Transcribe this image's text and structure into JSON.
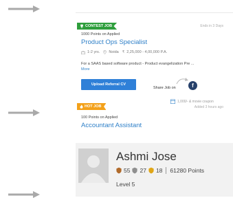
{
  "contest_job": {
    "badge": "CONTEST JOB",
    "ends_in": "Ends in 3 Days",
    "points": "1000 Points on Applied",
    "title": "Product Ops Specialist",
    "experience": "1-2 yrs.",
    "location": "Noida",
    "salary": "2,25,000 - 4,00,000 P.A.",
    "description": "For a SAAS based software product - Product evangelization Pre ...",
    "more_link": "More",
    "upload_button": "Upload Referral CV",
    "share_label": "Share Job on",
    "facebook_letter": "f"
  },
  "hot_job": {
    "badge": "HOT JOB",
    "coupon": "1,000/- & movie coupon",
    "added": "Added 3 hours ago",
    "points": "100 Points on Applied",
    "title": "Accountant Assistant"
  },
  "profile": {
    "name": "Ashmi Jose",
    "bronze_count": "55",
    "silver_count": "27",
    "gold_count": "18",
    "points": "61280 Points",
    "level": "Level 5"
  },
  "colors": {
    "arrow": "#a9a9a9",
    "contest_badge": "#2e9e3c",
    "hot_badge": "#f3a11a",
    "link_blue": "#2f80c8",
    "button_blue": "#2f80d8",
    "facebook": "#27416b",
    "profile_bg": "#f2f2f2"
  },
  "icons": {
    "arrow": "right-arrow-icon",
    "trophy": "trophy-icon",
    "briefcase": "briefcase-icon",
    "location": "location-pin-icon",
    "rupee": "rupee-icon",
    "calendar": "calendar-icon",
    "fire": "fire-icon",
    "avatar": "avatar-placeholder",
    "bronze": "bronze-medal-icon",
    "silver": "silver-medal-icon",
    "gold": "gold-medal-icon"
  }
}
